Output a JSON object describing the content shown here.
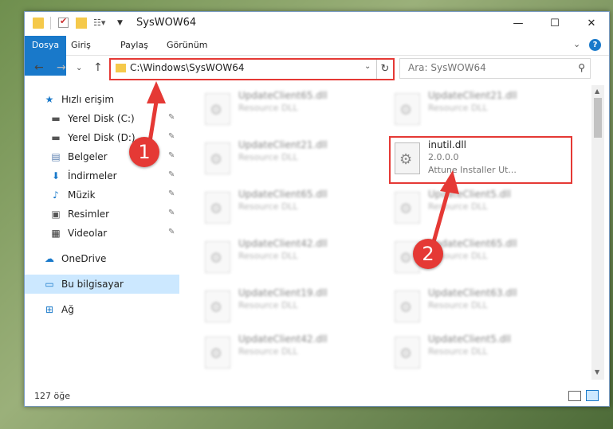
{
  "window": {
    "title": "SysWOW64",
    "minimize": "—",
    "maximize": "☐",
    "close": "✕"
  },
  "quick_access_toolbar": [
    "folder-icon",
    "properties-icon",
    "new-folder-icon",
    "customize-icon"
  ],
  "ribbon": {
    "tabs": [
      "Dosya",
      "Giriş",
      "Paylaş",
      "Görünüm"
    ],
    "expand": "⌄",
    "help": "?"
  },
  "nav": {
    "back": "←",
    "forward": "→",
    "recent": "⌄",
    "up": "↑",
    "address": "C:\\Windows\\SysWOW64",
    "dropdown": "⌄",
    "refresh": "↻",
    "search_placeholder": "Ara: SysWOW64"
  },
  "sidebar": {
    "items": [
      {
        "label": "Hızlı erişim",
        "icon": "star-icon",
        "pinned": false
      },
      {
        "label": "Yerel Disk (C:)",
        "icon": "drive-icon",
        "pinned": true
      },
      {
        "label": "Yerel Disk (D:)",
        "icon": "drive-icon",
        "pinned": true
      },
      {
        "label": "Belgeler",
        "icon": "documents-icon",
        "pinned": true
      },
      {
        "label": "İndirmeler",
        "icon": "download-icon",
        "pinned": true
      },
      {
        "label": "Müzik",
        "icon": "music-icon",
        "pinned": true
      },
      {
        "label": "Resimler",
        "icon": "pictures-icon",
        "pinned": true
      },
      {
        "label": "Videolar",
        "icon": "videos-icon",
        "pinned": true
      },
      {
        "label": "OneDrive",
        "icon": "cloud-icon",
        "pinned": false
      },
      {
        "label": "Bu bilgisayar",
        "icon": "computer-icon",
        "pinned": false,
        "selected": true
      },
      {
        "label": "Ağ",
        "icon": "network-icon",
        "pinned": false
      }
    ],
    "pin_glyph": "📌"
  },
  "files": {
    "left": [
      {
        "name": "UpdateClient65.dll",
        "type": "Resource DLL"
      },
      {
        "name": "UpdateClient21.dll",
        "type": "Resource DLL"
      },
      {
        "name": "UpdateClient65.dll",
        "type": "Resource DLL"
      },
      {
        "name": "UpdateClient42.dll",
        "type": "Resource DLL"
      },
      {
        "name": "UpdateClient19.dll",
        "type": "Resource DLL"
      },
      {
        "name": "UpdateClient42.dll",
        "type": "Resource DLL"
      }
    ],
    "right": [
      {
        "name": "UpdateClient21.dll",
        "type": "Resource DLL"
      },
      {
        "name": "UpdateClient5.dll",
        "type": "Resource DLL"
      },
      {
        "name": "UpdateClient65.dll",
        "type": "Resource DLL"
      },
      {
        "name": "UpdateClient63.dll",
        "type": "Resource DLL"
      },
      {
        "name": "UpdateClient5.dll",
        "type": "Resource DLL"
      }
    ],
    "highlighted": {
      "name": "inutil.dll",
      "version": "2.0.0.0",
      "company": "Attune Installer Ut..."
    }
  },
  "callouts": {
    "one": "1",
    "two": "2"
  },
  "status": {
    "count": "127 öğe"
  },
  "colors": {
    "accent": "#1979ca",
    "callout": "#e53935",
    "selected": "#cce8ff"
  }
}
